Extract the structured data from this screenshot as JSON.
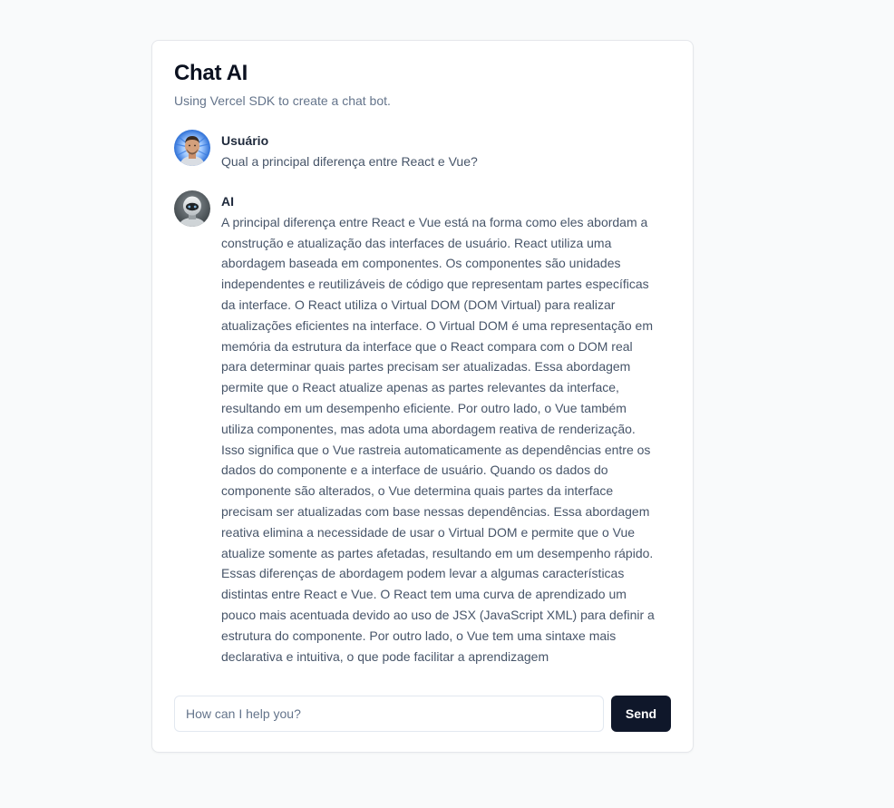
{
  "card": {
    "title": "Chat AI",
    "subtitle": "Using Vercel SDK to create a chat bot."
  },
  "messages": [
    {
      "author": "Usuário",
      "text": "Qual a principal diferença entre React e Vue?",
      "avatar": "user-photo"
    },
    {
      "author": "AI",
      "text": "A principal diferença entre React e Vue está na forma como eles abordam a construção e atualização das interfaces de usuário. React utiliza uma abordagem baseada em componentes. Os componentes são unidades independentes e reutilizáveis de código que representam partes específicas da interface. O React utiliza o Virtual DOM (DOM Virtual) para realizar atualizações eficientes na interface. O Virtual DOM é uma representação em memória da estrutura da interface que o React compara com o DOM real para determinar quais partes precisam ser atualizadas. Essa abordagem permite que o React atualize apenas as partes relevantes da interface, resultando em um desempenho eficiente. Por outro lado, o Vue também utiliza componentes, mas adota uma abordagem reativa de renderização. Isso significa que o Vue rastreia automaticamente as dependências entre os dados do componente e a interface de usuário. Quando os dados do componente são alterados, o Vue determina quais partes da interface precisam ser atualizadas com base nessas dependências. Essa abordagem reativa elimina a necessidade de usar o Virtual DOM e permite que o Vue atualize somente as partes afetadas, resultando em um desempenho rápido. Essas diferenças de abordagem podem levar a algumas características distintas entre React e Vue. O React tem uma curva de aprendizado um pouco mais acentuada devido ao uso de JSX (JavaScript XML) para definir a estrutura do componente. Por outro lado, o Vue tem uma sintaxe mais declarativa e intuitiva, o que pode facilitar a aprendizagem",
      "avatar": "robot-avatar"
    }
  ],
  "composer": {
    "placeholder": "How can I help you?",
    "value": "",
    "send_label": "Send"
  },
  "colors": {
    "background": "#f9fafb",
    "card": "#ffffff",
    "send_button": "#0f172a",
    "text_muted": "#64748b"
  }
}
